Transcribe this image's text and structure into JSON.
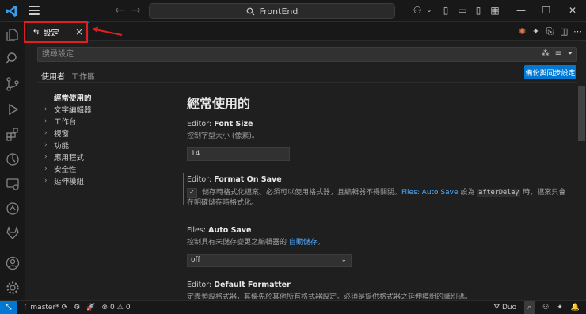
{
  "titlebar": {
    "search_text": "FrontEnd",
    "back_icon": "arrow-left-icon",
    "forward_icon": "arrow-right-icon"
  },
  "tab": {
    "label": "設定",
    "close": "×"
  },
  "settings_search": {
    "placeholder": "搜尋設定"
  },
  "scopes": {
    "user": "使用者",
    "workspace": "工作區",
    "sync_button": "備份與同步設定"
  },
  "toc": [
    {
      "label": "經常使用的",
      "header": true
    },
    {
      "label": "文字編輯器",
      "header": false
    },
    {
      "label": "工作台",
      "header": false
    },
    {
      "label": "視窗",
      "header": false
    },
    {
      "label": "功能",
      "header": false
    },
    {
      "label": "應用程式",
      "header": false
    },
    {
      "label": "安全性",
      "header": false
    },
    {
      "label": "延伸模組",
      "header": false
    }
  ],
  "main": {
    "title": "經常使用的",
    "font_size": {
      "prefix": "Editor: ",
      "name": "Font Size",
      "desc": "控制字型大小 (像素)。",
      "value": "14"
    },
    "format_on_save": {
      "prefix": "Editor: ",
      "name": "Format On Save",
      "desc_1": "儲存時格式化檔案。必須可以使用格式器，且編輯器不得關閉。",
      "link": "Files: Auto Save",
      "desc_2": " 設為 ",
      "code": "afterDelay",
      "desc_3": " 時，檔案只會在明確儲存時格式化。",
      "checked": true
    },
    "auto_save": {
      "prefix": "Files: ",
      "name": "Auto Save",
      "desc_1": "控制具有未儲存變更之編輯器的 ",
      "link": "自動儲存",
      "desc_2": "。",
      "value": "off"
    },
    "default_formatter": {
      "prefix": "Editor: ",
      "name": "Default Formatter",
      "desc": "定義預設格式器，其優先於其他所有格式器設定。必須是提供格式器之延伸模組的識別碼。"
    }
  },
  "statusbar": {
    "branch": "master*",
    "errors": "0",
    "warnings": "0",
    "duo": "Duo"
  }
}
